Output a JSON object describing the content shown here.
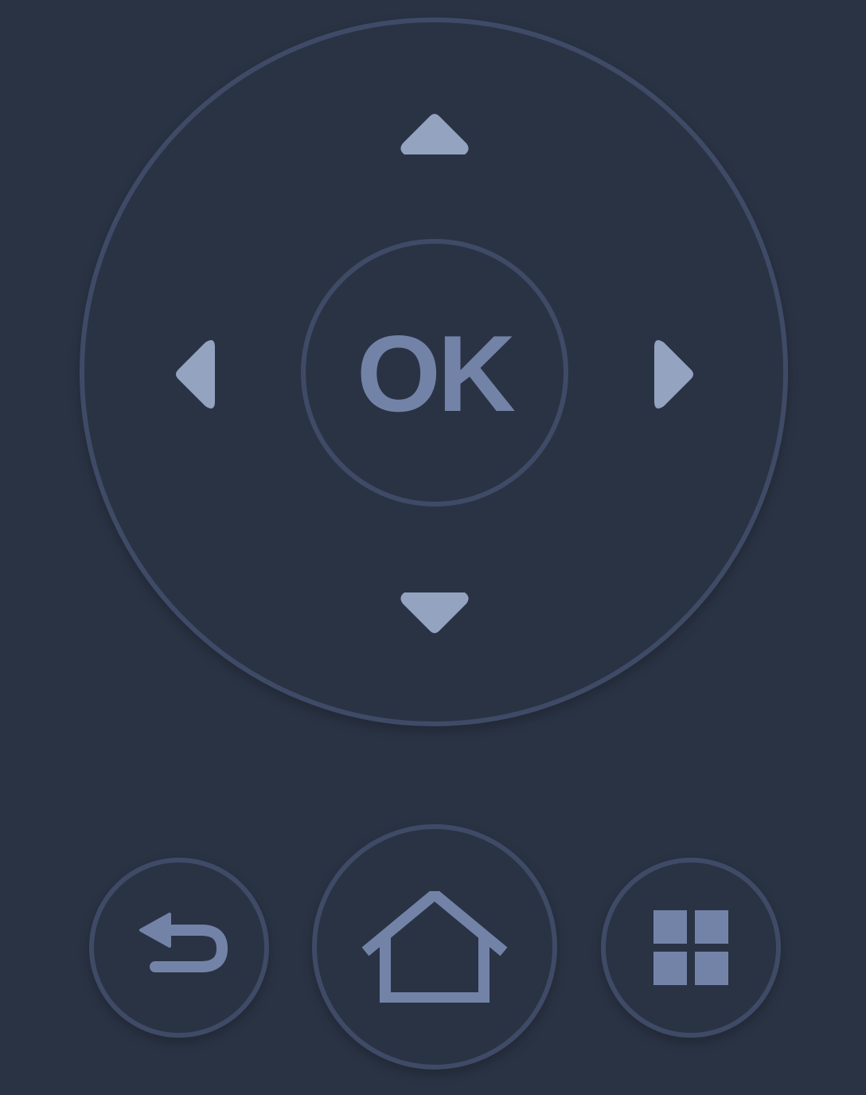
{
  "remote": {
    "ok_label": "OK",
    "icons": {
      "up": "arrow-up-icon",
      "down": "arrow-down-icon",
      "left": "arrow-left-icon",
      "right": "arrow-right-icon",
      "back": "back-icon",
      "home": "home-icon",
      "apps": "apps-grid-icon"
    },
    "colors": {
      "background": "#2a3344",
      "ring": "#3f4b66",
      "arrow": "#93a3c0",
      "icon": "#7383a8"
    }
  }
}
